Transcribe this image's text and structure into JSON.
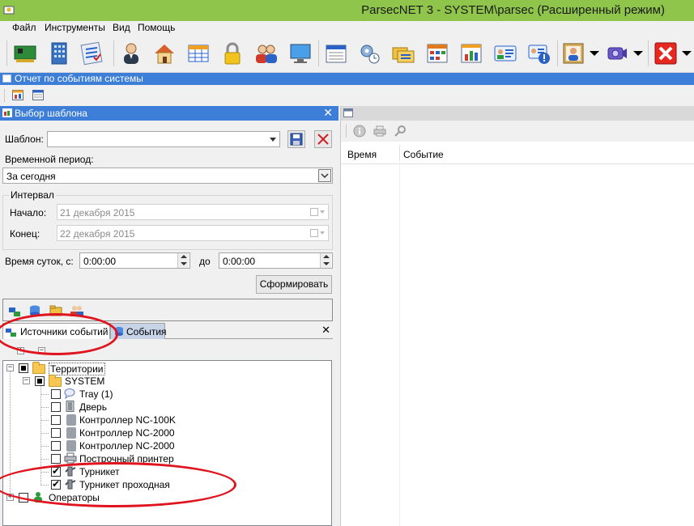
{
  "window": {
    "title": "ParsecNET 3 - SYSTEM\\parsec (Расширенный режим)"
  },
  "menu": {
    "items": [
      "Файл",
      "Инструменты",
      "Вид",
      "Помощь"
    ]
  },
  "toolbar": {
    "icons": [
      "network-card-icon",
      "building-icon",
      "checklist-icon",
      "user-icon",
      "home-icon",
      "table-icon",
      "lock-icon",
      "users-icon",
      "monitor-icon",
      "calendar-icon",
      "settings-schedule-icon",
      "folders-icon",
      "schedule-grid-icon",
      "chart-icon",
      "id-card-icon",
      "id-warning-icon",
      "photo-id-icon",
      "camera-icon",
      "exit-icon"
    ]
  },
  "report_window": {
    "title": "Отчет по событиям системы"
  },
  "template_panel": {
    "title": "Выбор шаблона",
    "template_label": "Шаблон:",
    "template_value": "",
    "period_label": "Временной период:",
    "period_value": "За сегодня",
    "interval_group": "Интервал",
    "start_label": "Начало:",
    "start_value": "21 декабря  2015",
    "end_label": "Конец:",
    "end_value": "22 декабря  2015",
    "time_label": "Время суток, с:",
    "time_from": "0:00:00",
    "time_to_label": "до",
    "time_to": "0:00:00",
    "generate_button": "Сформировать"
  },
  "tabs": {
    "sources": "Источники событий",
    "events": "События"
  },
  "tree": {
    "root": "Территории",
    "system": "SYSTEM",
    "items": [
      {
        "label": "Tray (1)",
        "checked": false
      },
      {
        "label": "Дверь",
        "checked": false
      },
      {
        "label": "Контроллер NC-100K",
        "checked": false
      },
      {
        "label": "Контроллер NC-2000",
        "checked": false
      },
      {
        "label": "Контроллер NC-2000",
        "checked": false
      },
      {
        "label": "Построчный принтер",
        "checked": false
      },
      {
        "label": "Турникет",
        "checked": true
      },
      {
        "label": "Турникет проходная",
        "checked": true
      }
    ],
    "operators": "Операторы"
  },
  "events_grid": {
    "columns": [
      "Время",
      "Событие"
    ]
  },
  "colors": {
    "titlebar": "#8fc54a",
    "panel_header": "#3c7ed8",
    "annotation": "#e0141e"
  }
}
